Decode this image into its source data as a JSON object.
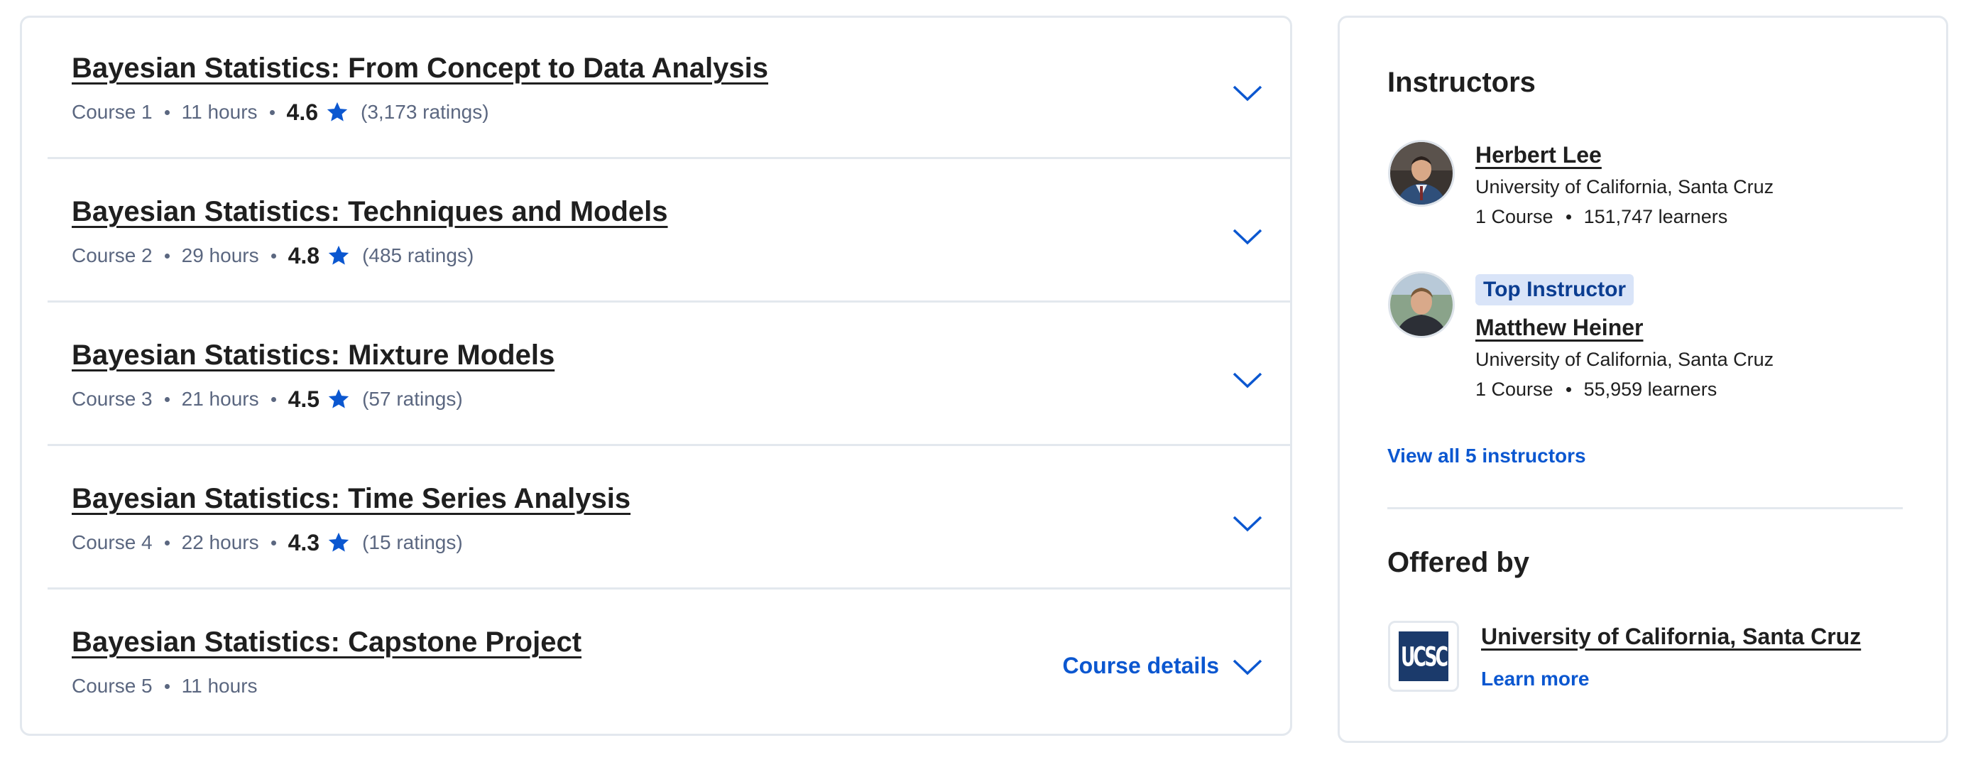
{
  "courses": [
    {
      "title": "Bayesian Statistics: From Concept to Data Analysis",
      "course": "Course 1",
      "hours": "11 hours",
      "rating": "4.6",
      "ratings_count": "(3,173 ratings)"
    },
    {
      "title": "Bayesian Statistics: Techniques and Models",
      "course": "Course 2",
      "hours": "29 hours",
      "rating": "4.8",
      "ratings_count": "(485 ratings)"
    },
    {
      "title": "Bayesian Statistics: Mixture Models",
      "course": "Course 3",
      "hours": "21 hours",
      "rating": "4.5",
      "ratings_count": "(57 ratings)"
    },
    {
      "title": "Bayesian Statistics: Time Series Analysis",
      "course": "Course 4",
      "hours": "22 hours",
      "rating": "4.3",
      "ratings_count": "(15 ratings)"
    },
    {
      "title": "Bayesian Statistics: Capstone Project",
      "course": "Course 5",
      "hours": "11 hours",
      "details_label": "Course details"
    }
  ],
  "icons": {
    "rating": "star-icon",
    "expand": "chevron-down-icon"
  },
  "colors": {
    "accent": "#0b57d0",
    "badge_bg": "#d9e4f8",
    "logo_bg": "#1b3a6b"
  },
  "sidebar": {
    "instructors_title": "Instructors",
    "instructors": [
      {
        "name": "Herbert Lee",
        "org": "University of California, Santa Cruz",
        "courses": "1 Course",
        "learners": "151,747 learners"
      },
      {
        "badge": "Top Instructor",
        "name": "Matthew Heiner",
        "org": "University of California, Santa Cruz",
        "courses": "1 Course",
        "learners": "55,959 learners"
      }
    ],
    "view_all": "View all 5 instructors",
    "offered_title": "Offered by",
    "offered": {
      "logo_text": "UCSC",
      "name": "University of California, Santa Cruz",
      "learn_more": "Learn more"
    }
  }
}
